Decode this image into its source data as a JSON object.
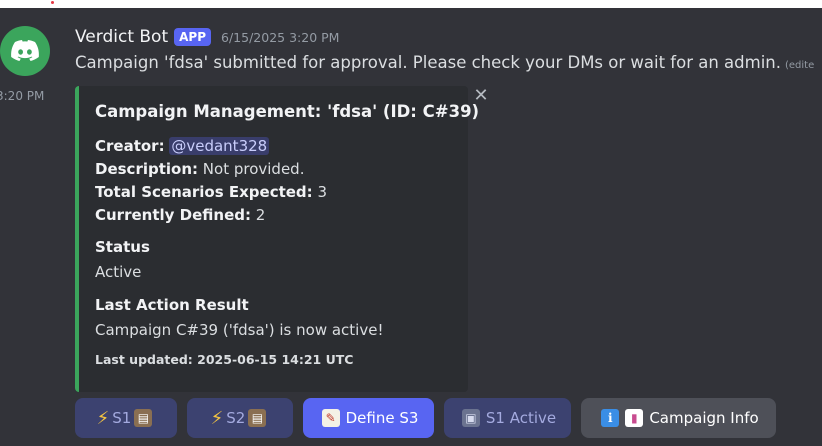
{
  "message": {
    "username": "Verdict Bot",
    "badge": "APP",
    "timestamp": "6/15/2025 3:20 PM",
    "text": "Campaign 'fdsa' submitted for approval. Please check your DMs or wait for an admin.",
    "edited": "(edite",
    "side_time": "3:20 PM"
  },
  "embed": {
    "title": "Campaign Management: 'fdsa' (ID: C#39)",
    "creator_label": "Creator:",
    "creator_value": "@vedant328",
    "description_label": "Description:",
    "description_value": "Not provided.",
    "total_label": "Total Scenarios Expected:",
    "total_value": "3",
    "defined_label": "Currently Defined:",
    "defined_value": "2",
    "status_title": "Status",
    "status_value": "Active",
    "last_action_title": "Last Action Result",
    "last_action_value": "Campaign C#39 ('fdsa') is now active!",
    "footer": "Last updated: 2025-06-15 14:21 UTC",
    "accent": "#3ba55c"
  },
  "buttons": {
    "s1": "S1",
    "s2": "S2",
    "define_s3": "Define S3",
    "s1_active": "S1 Active",
    "campaign_info": "Campaign Info"
  },
  "colors": {
    "background": "#323339",
    "primary_button": "#5865f2",
    "secondary_button": "#4e5058",
    "app_badge": "#5865f2"
  }
}
